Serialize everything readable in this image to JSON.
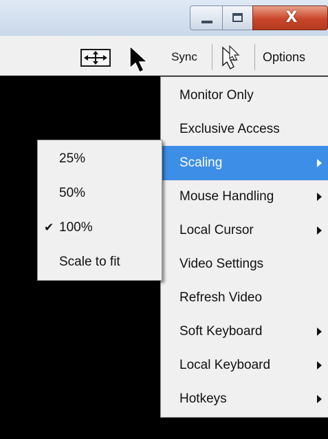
{
  "window": {
    "minimize_icon": "minimize-icon",
    "maximize_icon": "maximize-icon",
    "close_label": "X",
    "close_color": "#c9462a"
  },
  "toolbar": {
    "fit_icon": "fit-to-window-icon",
    "cursor_icon": "arrow-cursor-icon",
    "sync_label": "Sync",
    "hide_cursor_icon": "hollow-cursor-icon",
    "options_label": "Options"
  },
  "options_menu": {
    "items": [
      {
        "label": "Monitor Only",
        "submenu": false
      },
      {
        "label": "Exclusive Access",
        "submenu": false
      },
      {
        "label": "Scaling",
        "submenu": true,
        "active": true
      },
      {
        "label": "Mouse Handling",
        "submenu": true
      },
      {
        "label": "Local Cursor",
        "submenu": true
      },
      {
        "label": "Video Settings",
        "submenu": false
      },
      {
        "label": "Refresh Video",
        "submenu": false
      },
      {
        "label": "Soft Keyboard",
        "submenu": true
      },
      {
        "label": "Local Keyboard",
        "submenu": true
      },
      {
        "label": "Hotkeys",
        "submenu": true
      }
    ],
    "highlight_color": "#3d8ee6"
  },
  "scaling_submenu": {
    "items": [
      {
        "label": "25%",
        "checked": false
      },
      {
        "label": "50%",
        "checked": false
      },
      {
        "label": "100%",
        "checked": true
      },
      {
        "label": "Scale to fit",
        "checked": false
      }
    ],
    "check_glyph": "✔"
  }
}
